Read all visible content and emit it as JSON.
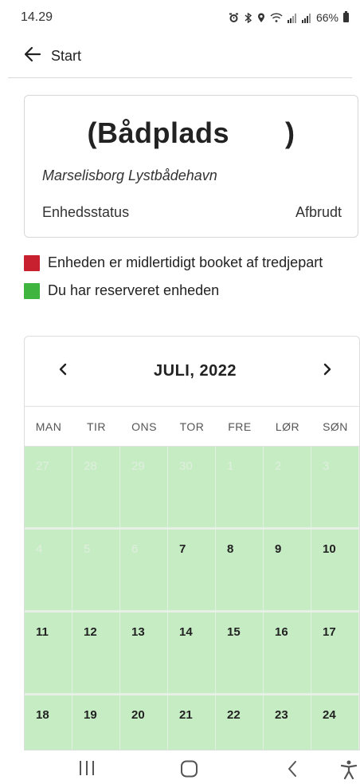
{
  "status_bar": {
    "time": "14.29",
    "battery": "66%",
    "icons": [
      "alarm-icon",
      "bluetooth-icon",
      "location-icon",
      "wifi-icon",
      "signal-icon",
      "signal-icon",
      "battery-icon"
    ]
  },
  "top_bar": {
    "back_label": "Start"
  },
  "unit": {
    "title_open": "(Bådplads",
    "title_close": ")",
    "harbor": "Marselisborg Lystbådehavn",
    "status_label": "Enhedsstatus",
    "status_value": "Afbrudt"
  },
  "legend": {
    "items": [
      {
        "color": "#c8202f",
        "text": "Enheden er midlertidigt booket af tredjepart"
      },
      {
        "color": "#3fb53f",
        "text": "Du har reserveret enheden"
      }
    ]
  },
  "calendar": {
    "month_label": "JULI, 2022",
    "weekdays": [
      "MAN",
      "TIR",
      "ONS",
      "TOR",
      "FRE",
      "LØR",
      "SØN"
    ],
    "weeks": [
      [
        {
          "d": "27",
          "faded": true
        },
        {
          "d": "28",
          "faded": true
        },
        {
          "d": "29",
          "faded": true
        },
        {
          "d": "30",
          "faded": true
        },
        {
          "d": "1",
          "faded": true
        },
        {
          "d": "2",
          "faded": true
        },
        {
          "d": "3",
          "faded": true
        }
      ],
      [
        {
          "d": "4",
          "faded": true
        },
        {
          "d": "5",
          "faded": true
        },
        {
          "d": "6",
          "faded": true
        },
        {
          "d": "7",
          "faded": false
        },
        {
          "d": "8",
          "faded": false
        },
        {
          "d": "9",
          "faded": false
        },
        {
          "d": "10",
          "faded": false
        }
      ],
      [
        {
          "d": "11",
          "faded": false
        },
        {
          "d": "12",
          "faded": false
        },
        {
          "d": "13",
          "faded": false
        },
        {
          "d": "14",
          "faded": false
        },
        {
          "d": "15",
          "faded": false
        },
        {
          "d": "16",
          "faded": false
        },
        {
          "d": "17",
          "faded": false
        }
      ],
      [
        {
          "d": "18",
          "faded": false
        },
        {
          "d": "19",
          "faded": false
        },
        {
          "d": "20",
          "faded": false
        },
        {
          "d": "21",
          "faded": false
        },
        {
          "d": "22",
          "faded": false
        },
        {
          "d": "23",
          "faded": false
        },
        {
          "d": "24",
          "faded": false
        }
      ]
    ],
    "reserved_color": "#c6ecc4"
  },
  "nav_bar": {
    "icons": [
      "recent-apps-icon",
      "home-icon",
      "back-icon",
      "accessibility-icon"
    ]
  }
}
